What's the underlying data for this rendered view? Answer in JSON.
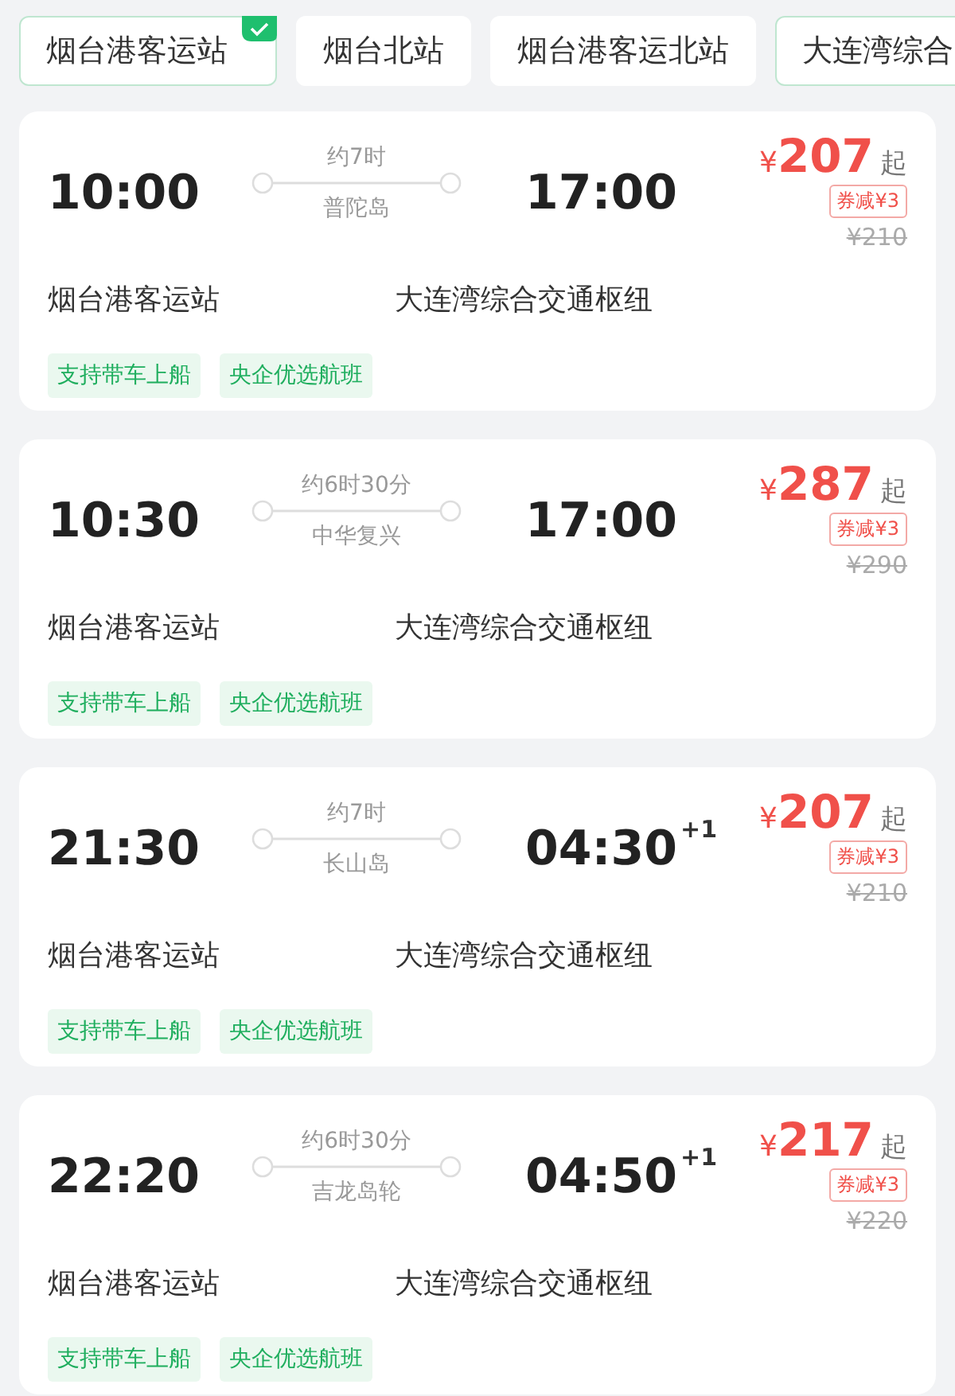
{
  "station_tabs": [
    {
      "label": "烟台港客运站",
      "selected": true,
      "checked": true
    },
    {
      "label": "烟台北站",
      "selected": false,
      "checked": false
    },
    {
      "label": "烟台港客运北站",
      "selected": false,
      "checked": false
    },
    {
      "label": "大连湾综合",
      "selected": true,
      "checked": false
    }
  ],
  "sailings": [
    {
      "depart_time": "10:00",
      "duration": "约7时",
      "ship": "普陀岛",
      "arrive_time": "17:00",
      "currency": "¥",
      "price": "207",
      "price_suffix": "起",
      "coupon": "券减¥3",
      "original_price": "¥210",
      "from": "烟台港客运站",
      "to": "大连湾综合交通枢纽",
      "tags": [
        "支持带车上船",
        "央企优选航班"
      ]
    },
    {
      "depart_time": "10:30",
      "duration": "约6时30分",
      "ship": "中华复兴",
      "arrive_time": "17:00",
      "currency": "¥",
      "price": "287",
      "price_suffix": "起",
      "coupon": "券减¥3",
      "original_price": "¥290",
      "from": "烟台港客运站",
      "to": "大连湾综合交通枢纽",
      "tags": [
        "支持带车上船",
        "央企优选航班"
      ]
    },
    {
      "depart_time": "21:30",
      "duration": "约7时",
      "ship": "长山岛",
      "arrive_time": "04:30",
      "arrive_day": "+1",
      "currency": "¥",
      "price": "207",
      "price_suffix": "起",
      "coupon": "券减¥3",
      "original_price": "¥210",
      "from": "烟台港客运站",
      "to": "大连湾综合交通枢纽",
      "tags": [
        "支持带车上船",
        "央企优选航班"
      ]
    },
    {
      "depart_time": "22:20",
      "duration": "约6时30分",
      "ship": "吉龙岛轮",
      "arrive_time": "04:50",
      "arrive_day": "+1",
      "currency": "¥",
      "price": "217",
      "price_suffix": "起",
      "coupon": "券减¥3",
      "original_price": "¥220",
      "from": "烟台港客运站",
      "to": "大连湾综合交通枢纽",
      "tags": [
        "支持带车上船",
        "央企优选航班"
      ]
    }
  ]
}
